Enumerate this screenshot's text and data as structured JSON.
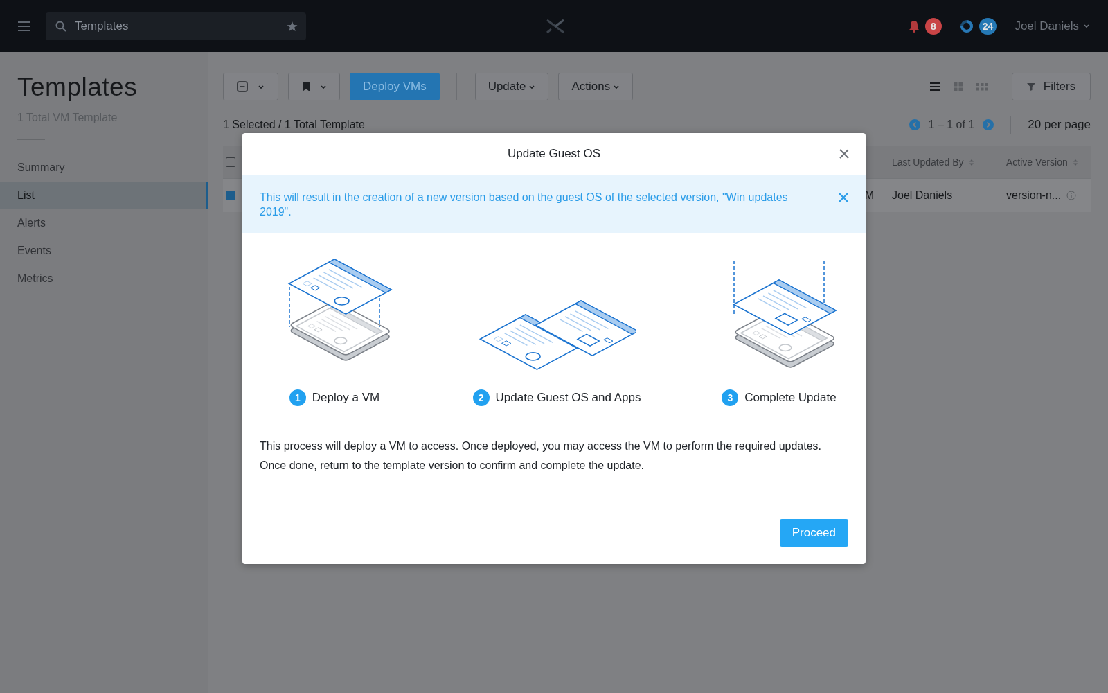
{
  "top_bar": {
    "search": {
      "value": "Templates"
    },
    "badges": [
      {
        "kind": "alerts",
        "count": "8",
        "color": "#c94446"
      },
      {
        "kind": "tasks",
        "count": "24",
        "color": "#2578b4"
      }
    ],
    "user": "Joel Daniels"
  },
  "sidebar": {
    "title": "Templates",
    "subtitle": "1 Total VM Template",
    "items": [
      {
        "label": "Summary",
        "selected": false
      },
      {
        "label": "List",
        "selected": true
      },
      {
        "label": "Alerts",
        "selected": false
      },
      {
        "label": "Events",
        "selected": false
      },
      {
        "label": "Metrics",
        "selected": false
      }
    ]
  },
  "toolbar": {
    "buttons": [
      {
        "kind": "select"
      },
      {
        "kind": "bookmark"
      },
      {
        "kind": "primary",
        "label": "Deploy VMs"
      },
      {
        "kind": "menu",
        "label": "Update"
      },
      {
        "kind": "menu",
        "label": "Actions"
      }
    ],
    "views": [
      {
        "kind": "list",
        "selected": true
      },
      {
        "kind": "grid",
        "selected": false
      },
      {
        "kind": "tiles",
        "selected": false
      }
    ],
    "filters": "Filters"
  },
  "selection_summary": "1 Selected / 1 Total Template",
  "pagination": {
    "range": "1 – 1 of 1",
    "per_page": "20 per page"
  },
  "table": {
    "columns": [
      {
        "kind": "checkbox",
        "checked": false
      },
      {
        "kind": "hidden"
      },
      {
        "kind": "text",
        "label": "Last Updated By"
      },
      {
        "kind": "text",
        "label": "Active Version"
      }
    ],
    "rows": [
      {
        "checked": true,
        "column_3": "M",
        "last_updated_by": "Joel Daniels",
        "active_version": "version-n..."
      }
    ]
  },
  "modal": {
    "title": "Update Guest OS",
    "banner": "This will result in the creation of a new version based on the guest OS of the selected version, \"Win updates 2019\".",
    "steps": [
      {
        "kind": "deploy",
        "number": "1",
        "label": "Deploy a VM"
      },
      {
        "kind": "update",
        "number": "2",
        "label": "Update Guest OS and Apps"
      },
      {
        "kind": "complete",
        "number": "3",
        "label": "Complete Update"
      }
    ],
    "description": "This process will deploy a VM to access. Once deployed, you may access the VM to perform the required updates. Once done, return to the template version to confirm and complete the update.",
    "button": "Proceed"
  }
}
